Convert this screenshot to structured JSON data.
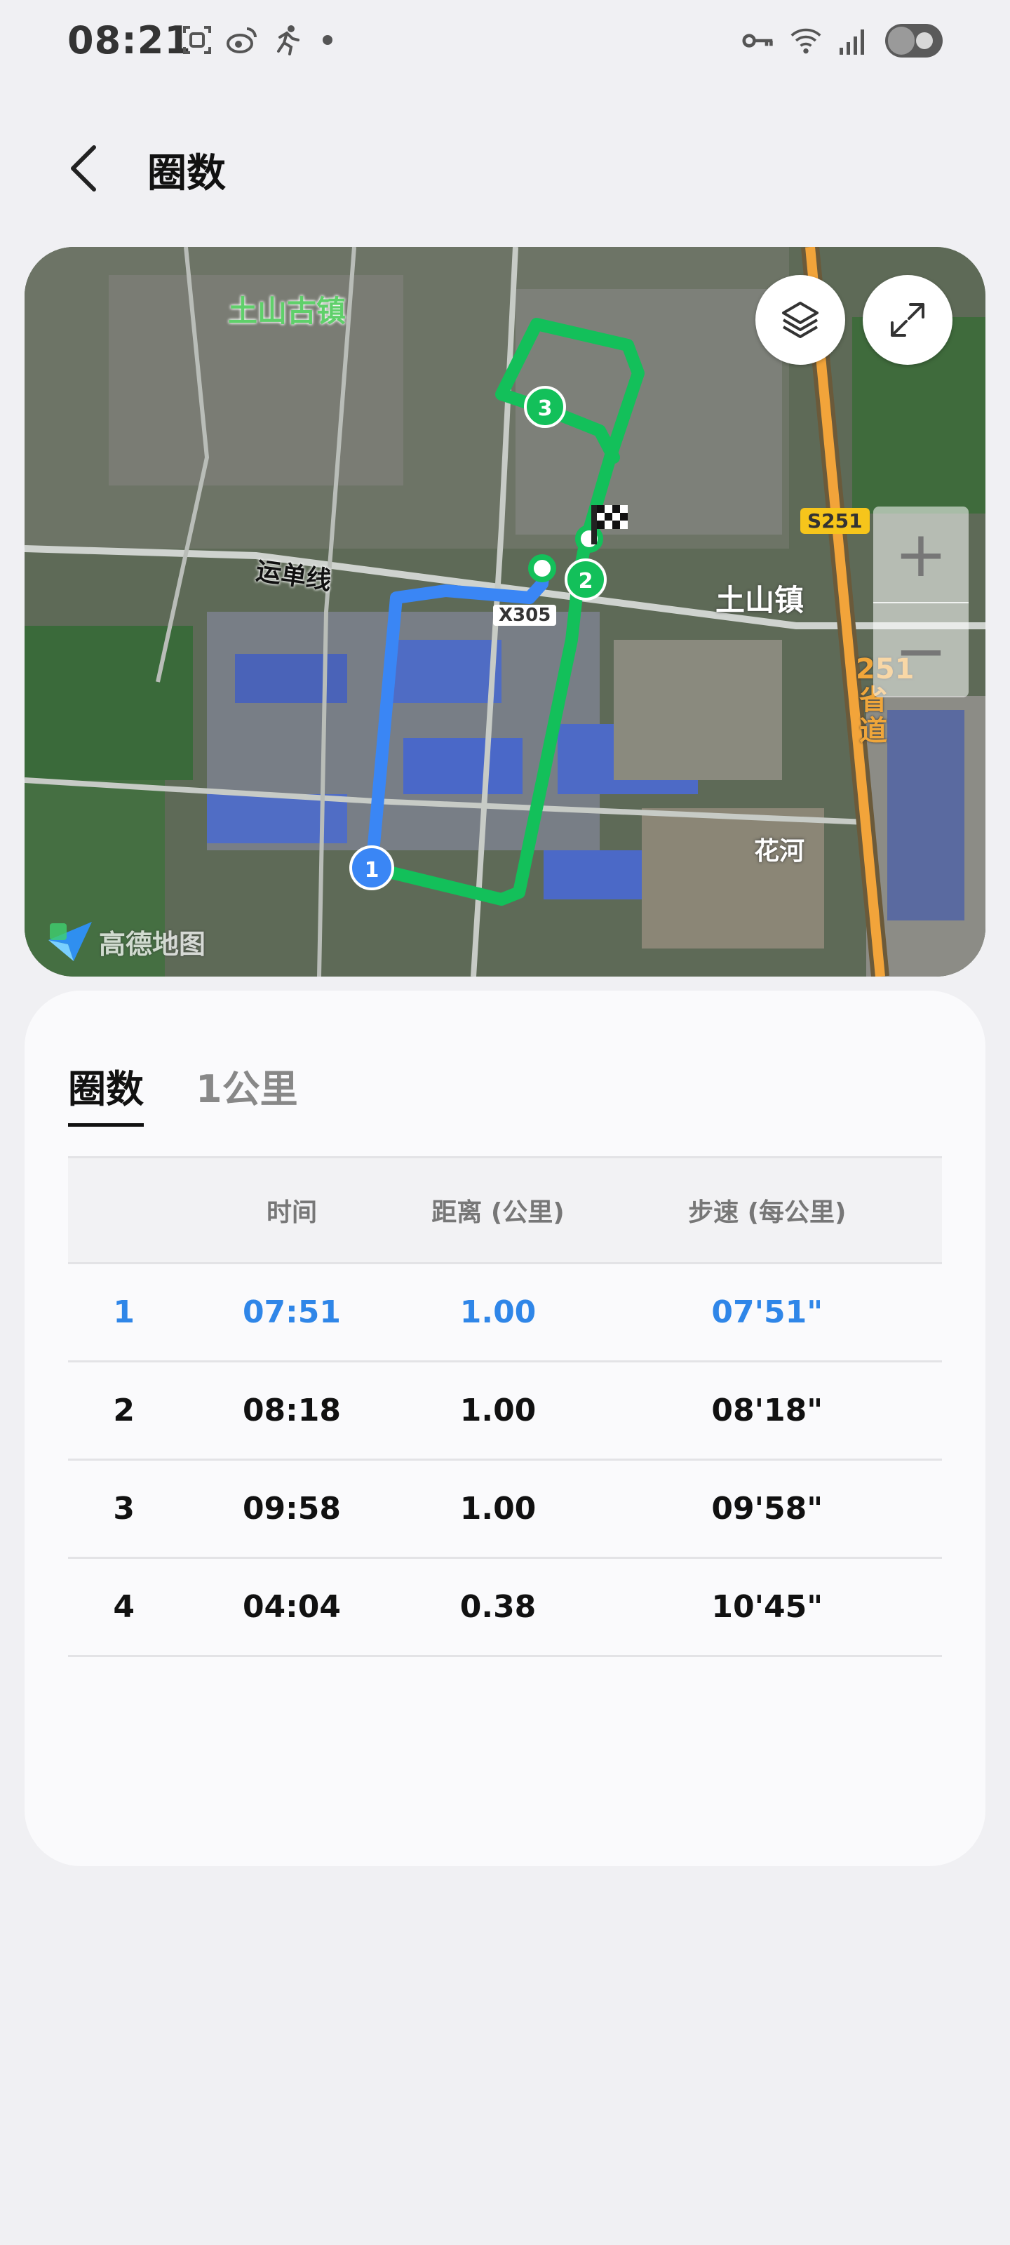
{
  "status_bar": {
    "time": "08:21",
    "left_icons": [
      "screenshot-icon",
      "weibo-icon",
      "running-icon",
      "dot"
    ],
    "right_icons": [
      "key-icon",
      "wifi-icon",
      "signal-icon",
      "battery-icon"
    ]
  },
  "header": {
    "title": "圈数",
    "back_icon": "back-chevron-icon"
  },
  "map": {
    "labels": {
      "old_town": "土山古镇",
      "town": "土山镇",
      "road": "运单线",
      "river": "花河",
      "provincial_road": "251省道"
    },
    "badges": {
      "s251": "S251",
      "x305": "X305"
    },
    "markers": [
      "1",
      "2",
      "3"
    ],
    "logo_text": "高德地图",
    "buttons": [
      "layers-icon",
      "fullscreen-icon"
    ],
    "zoom": {
      "in": "+",
      "out": "−"
    },
    "colors": {
      "route_lap1": "#3a86f5",
      "route_other": "#13c05a"
    }
  },
  "laps": {
    "tabs": [
      {
        "label": "圈数",
        "active": true
      },
      {
        "label": "1公里",
        "active": false
      }
    ],
    "columns": [
      "",
      "时间",
      "距离 (公里)",
      "步速 (每公里)"
    ],
    "rows": [
      {
        "lap": "1",
        "time": "07:51",
        "distance": "1.00",
        "pace": "07'51\"",
        "highlight": true
      },
      {
        "lap": "2",
        "time": "08:18",
        "distance": "1.00",
        "pace": "08'18\"",
        "highlight": false
      },
      {
        "lap": "3",
        "time": "09:58",
        "distance": "1.00",
        "pace": "09'58\"",
        "highlight": false
      },
      {
        "lap": "4",
        "time": "04:04",
        "distance": "0.38",
        "pace": "10'45\"",
        "highlight": false
      }
    ],
    "highlight_color": "#2f86e8"
  }
}
